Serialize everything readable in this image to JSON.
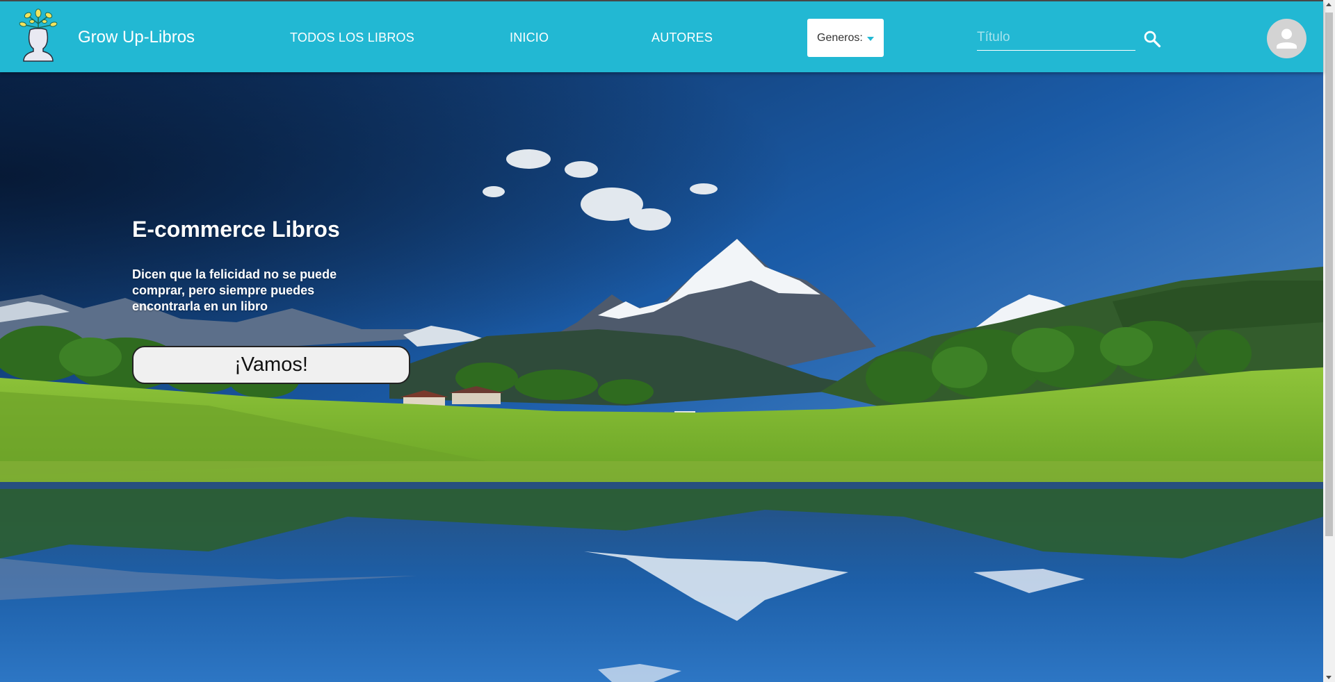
{
  "header": {
    "brand": "Grow Up-Libros",
    "nav": {
      "all_books": "TODOS LOS LIBROS",
      "home": "INICIO",
      "authors": "AUTORES"
    },
    "genre_select": {
      "label": "Generos:"
    },
    "search": {
      "placeholder": "Título",
      "value": ""
    },
    "colors": {
      "bar": "#22b8d3",
      "text": "#ffffff"
    },
    "icons": {
      "logo": "head-with-sprouting-plant-logo",
      "search": "search-icon",
      "avatar": "user-avatar-icon"
    }
  },
  "hero": {
    "title": "E-commerce Libros",
    "text": "Dicen que la felicidad no se puede comprar, pero siempre puedes encontrarla en un libro",
    "button_label": "¡Vamos!",
    "background": "mountain-lake-landscape"
  }
}
